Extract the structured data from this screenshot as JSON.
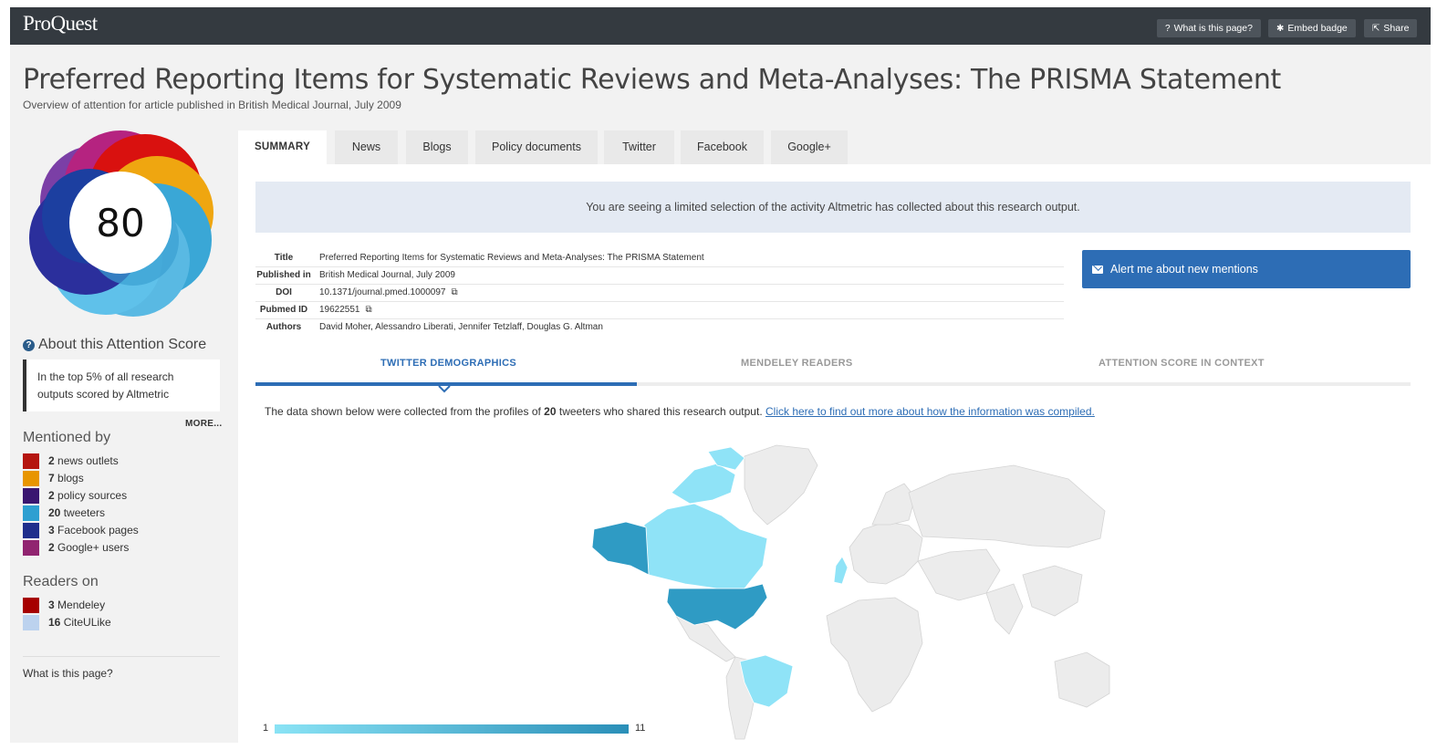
{
  "topbar": {
    "brand": "ProQuest",
    "buttons": [
      {
        "icon": "question-icon",
        "glyph": "?",
        "label": "What is this page?"
      },
      {
        "icon": "pin-icon",
        "glyph": "✱",
        "label": "Embed badge"
      },
      {
        "icon": "share-icon",
        "glyph": "⇱",
        "label": "Share"
      }
    ]
  },
  "page": {
    "title": "Preferred Reporting Items for Systematic Reviews and Meta-Analyses: The PRISMA Statement",
    "subtitle": "Overview of attention for article published in British Medical Journal, July 2009"
  },
  "score": {
    "value": "80",
    "about_title": "About this Attention Score",
    "summary": "In the top 5% of all research outputs scored by Altmetric",
    "more": "MORE..."
  },
  "mentioned_by": {
    "heading": "Mentioned by",
    "items": [
      {
        "count": "2",
        "label": "news outlets",
        "color": "#b5150f"
      },
      {
        "count": "7",
        "label": "blogs",
        "color": "#e89500"
      },
      {
        "count": "2",
        "label": "policy sources",
        "color": "#3a1670"
      },
      {
        "count": "20",
        "label": "tweeters",
        "color": "#2e9fd1"
      },
      {
        "count": "3",
        "label": "Facebook pages",
        "color": "#1f2e8c"
      },
      {
        "count": "2",
        "label": "Google+ users",
        "color": "#912470"
      }
    ]
  },
  "readers_on": {
    "heading": "Readers on",
    "items": [
      {
        "count": "3",
        "label": "Mendeley",
        "color": "#a60000"
      },
      {
        "count": "16",
        "label": "CiteULike",
        "color": "#bcd2ee"
      }
    ]
  },
  "footer_link": "What is this page?",
  "tabs": [
    "SUMMARY",
    "News",
    "Blogs",
    "Policy documents",
    "Twitter",
    "Facebook",
    "Google+"
  ],
  "notice": "You are seeing a limited selection of the activity Altmetric has collected about this research output.",
  "meta": {
    "title_key": "Title",
    "title_val": "Preferred Reporting Items for Systematic Reviews and Meta-Analyses: The PRISMA Statement",
    "published_key": "Published in",
    "published_val": "British Medical Journal, July 2009",
    "doi_key": "DOI",
    "doi_val": "10.1371/journal.pmed.1000097",
    "pubmed_key": "Pubmed ID",
    "pubmed_val": "19622551",
    "authors_key": "Authors",
    "authors_val": "David Moher, Alessandro Liberati, Jennifer Tetzlaff, Douglas G. Altman"
  },
  "alert_button": "Alert me about new mentions",
  "subtabs": [
    "TWITTER DEMOGRAPHICS",
    "MENDELEY READERS",
    "ATTENTION SCORE IN CONTEXT"
  ],
  "description": {
    "before": "The data shown below were collected from the profiles of ",
    "count": "20",
    "after": " tweeters who shared this research output. ",
    "link": "Click here to find out more about how the information was compiled."
  },
  "legend": {
    "min": "1",
    "max": "11"
  },
  "colors": {
    "accent": "#2d6db5",
    "topbar": "#343a40",
    "notice_bg": "#e4eaf3"
  }
}
